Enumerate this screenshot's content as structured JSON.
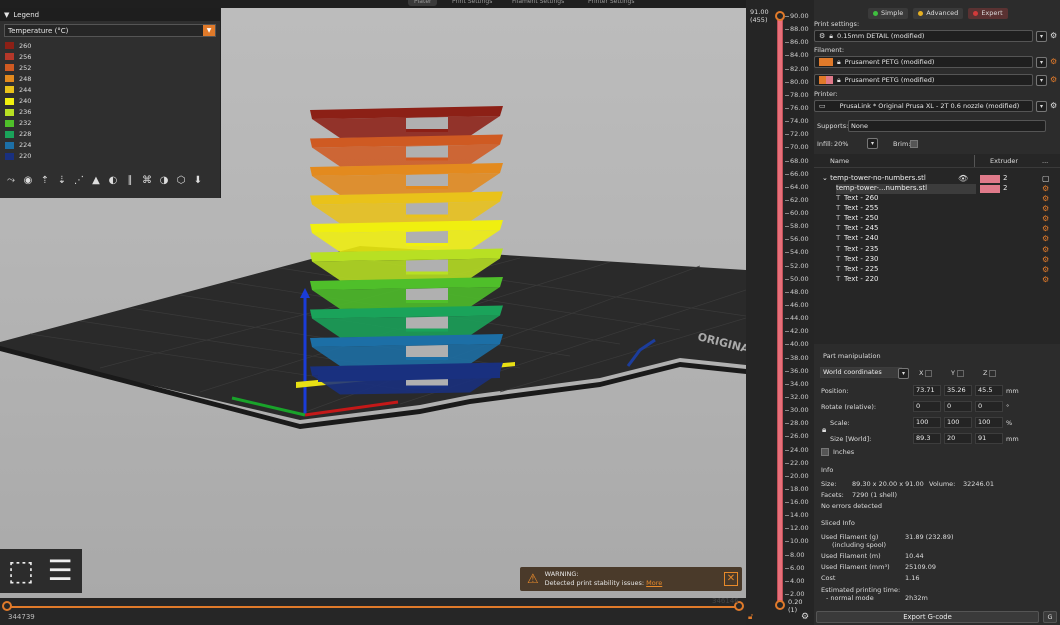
{
  "topbar": {
    "tabs": [
      {
        "label": "Plater",
        "active": true
      },
      {
        "label": "Print Settings",
        "active": false
      },
      {
        "label": "Filament Settings",
        "active": false
      },
      {
        "label": "Printer Settings",
        "active": false
      }
    ]
  },
  "legend": {
    "title": "Legend",
    "selector": "Temperature (°C)",
    "entries": [
      {
        "label": "260",
        "color": "#8c2016"
      },
      {
        "label": "256",
        "color": "#b5382a"
      },
      {
        "label": "252",
        "color": "#cf5a22"
      },
      {
        "label": "248",
        "color": "#e38a1e"
      },
      {
        "label": "244",
        "color": "#e9c21a"
      },
      {
        "label": "240",
        "color": "#f0ef0f"
      },
      {
        "label": "236",
        "color": "#b8e023"
      },
      {
        "label": "232",
        "color": "#4fbf2a"
      },
      {
        "label": "228",
        "color": "#1aa35a"
      },
      {
        "label": "224",
        "color": "#1c6fa6"
      },
      {
        "label": "220",
        "color": "#19307f"
      }
    ],
    "icons": [
      "travel-icon",
      "wipe-icon",
      "retractions-icon",
      "deretractions-icon",
      "seams-icon",
      "tool-changes-icon",
      "color-changes-icon",
      "pause-prints-icon",
      "custom-gcodes-icon",
      "center-of-gravity-icon",
      "shells-icon",
      "tool-marker-icon"
    ]
  },
  "viewport": {
    "bed_label": "ORIGINAL PRUSA",
    "warning": {
      "title": "WARNING:",
      "message": "Detected print stability issues:",
      "link": "More"
    },
    "h_slider": {
      "left": "344739",
      "right": "346146"
    }
  },
  "vslider": {
    "top_a": "91.00",
    "top_b": "(455)",
    "bottom_a": "0.20",
    "bottom_b": "(1)",
    "ticks": [
      "90.00",
      "88.00",
      "86.00",
      "84.00",
      "82.00",
      "80.00",
      "78.00",
      "76.00",
      "74.00",
      "72.00",
      "70.00",
      "68.00",
      "66.00",
      "64.00",
      "62.00",
      "60.00",
      "58.00",
      "56.00",
      "54.00",
      "52.00",
      "50.00",
      "48.00",
      "46.00",
      "44.00",
      "42.00",
      "40.00",
      "38.00",
      "36.00",
      "34.00",
      "32.00",
      "30.00",
      "28.00",
      "26.00",
      "24.00",
      "22.00",
      "20.00",
      "18.00",
      "16.00",
      "14.00",
      "12.00",
      "10.00",
      "8.00",
      "6.00",
      "4.00",
      "2.00"
    ]
  },
  "panel": {
    "modes": [
      {
        "label": "Simple",
        "color": "#3fbf3f",
        "active": false
      },
      {
        "label": "Advanced",
        "color": "#e6b022",
        "active": false
      },
      {
        "label": "Expert",
        "color": "#d23a3a",
        "active": true
      }
    ],
    "print_settings_label": "Print settings:",
    "print_settings_value": "0.15mm DETAIL (modified)",
    "filament_label": "Filament:",
    "filaments": [
      {
        "value": "Prusament PETG (modified)",
        "color": "#e07a2a"
      },
      {
        "value": "Prusament PETG (modified)",
        "color": "#e07a8a"
      }
    ],
    "printer_label": "Printer:",
    "printer_value": "PrusaLink * Original Prusa XL - 2T 0.6 nozzle (modified)",
    "supports_label": "Supports:",
    "supports_value": "None",
    "infill_label": "Infill:",
    "infill_value": "20%",
    "brim_label": "Brim:",
    "table": {
      "col_name": "Name",
      "col_extruder": "Extruder",
      "col_more": "...",
      "object": {
        "name": "temp-tower-no-numbers.stl",
        "extruder": "2"
      },
      "part": {
        "name": "temp-tower-...numbers.stl",
        "extruder": "2"
      },
      "texts": [
        "Text - 260",
        "Text - 255",
        "Text - 250",
        "Text - 245",
        "Text - 240",
        "Text - 235",
        "Text - 230",
        "Text - 225",
        "Text - 220"
      ]
    },
    "part_manipulation": {
      "title": "Part manipulation",
      "coords": "World coordinates",
      "axis_x": "X",
      "axis_y": "Y",
      "axis_z": "Z",
      "position_label": "Position:",
      "position": [
        "73.71",
        "35.26",
        "45.5"
      ],
      "position_unit": "mm",
      "rotate_label": "Rotate (relative):",
      "rotate": [
        "0",
        "0",
        "0"
      ],
      "rotate_unit": "°",
      "scale_label": "Scale:",
      "scale": [
        "100",
        "100",
        "100"
      ],
      "scale_unit": "%",
      "size_label": "Size [World]:",
      "size": [
        "89.3",
        "20",
        "91"
      ],
      "size_unit": "mm",
      "inches_label": "Inches"
    },
    "info": {
      "title": "Info",
      "size_label": "Size:",
      "size_value": "89.30 x 20.00 x 91.00",
      "volume_label": "Volume:",
      "volume_value": "32246.01",
      "facets_label": "Facets:",
      "facets_value": "7290 (1 shell)",
      "errors": "No errors detected"
    },
    "sliced": {
      "title": "Sliced Info",
      "rows": [
        {
          "label": "Used Filament (g)",
          "sub": "(including spool)",
          "value": "31.89 (232.89)"
        },
        {
          "label": "Used Filament (m)",
          "value": "10.44"
        },
        {
          "label": "Used Filament (mm³)",
          "value": "25109.09"
        },
        {
          "label": "Cost",
          "value": "1.16"
        },
        {
          "label": "Estimated printing time:",
          "sub": "- normal mode",
          "value": "2h32m"
        }
      ]
    },
    "export_label": "Export G-code",
    "export_side": "G"
  }
}
